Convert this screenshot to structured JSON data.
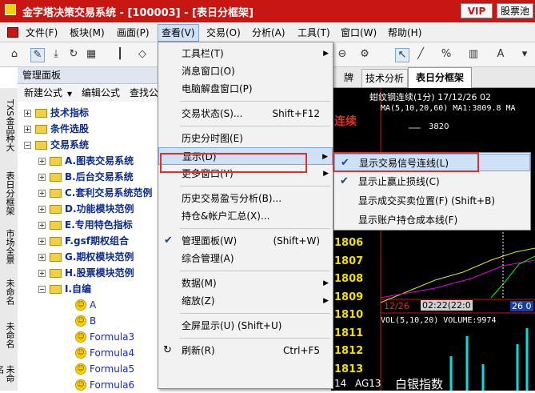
{
  "window": {
    "title": "金字塔决策交易系统 - [100003] - [表日分框架]",
    "vip": "VIP",
    "pool": "股票池"
  },
  "menubar": [
    "文件(F)",
    "板块(M)",
    "画面(P)",
    "查看(V)",
    "交易(O)",
    "分析(A)",
    "工具(T)",
    "窗口(W)",
    "帮助(H)"
  ],
  "left_tabs": [
    "TXS金品种大",
    "表日分框架",
    "市场全景",
    "未命名",
    "未命名",
    "未命名"
  ],
  "panel": {
    "title": "管理面板",
    "tools": [
      "新建公式",
      "编辑公式",
      "查找公"
    ]
  },
  "tree": [
    {
      "label": "技术指标",
      "level": 0,
      "open": false
    },
    {
      "label": "条件选股",
      "level": 0,
      "open": false
    },
    {
      "label": "交易系统",
      "level": 0,
      "open": true
    },
    {
      "label": "A.图表交易系统",
      "level": 1,
      "open": false
    },
    {
      "label": "B.后台交易系统",
      "level": 1,
      "open": false
    },
    {
      "label": "C.套利交易系统范例",
      "level": 1,
      "open": false
    },
    {
      "label": "D.功能模块范例",
      "level": 1,
      "open": false
    },
    {
      "label": "E.专用特色指标",
      "level": 1,
      "open": false
    },
    {
      "label": "F.gsf期权组合",
      "level": 1,
      "open": false
    },
    {
      "label": "G.期权模块范例",
      "level": 1,
      "open": false
    },
    {
      "label": "H.股票模块范例",
      "level": 1,
      "open": false
    },
    {
      "label": "I.自编",
      "level": 1,
      "open": true
    },
    {
      "label": "A",
      "level": 2,
      "leaf": true
    },
    {
      "label": "B",
      "level": 2,
      "leaf": true
    },
    {
      "label": "Formula3",
      "level": 2,
      "leaf": true
    },
    {
      "label": "Formula4",
      "level": 2,
      "leaf": true
    },
    {
      "label": "Formula5",
      "level": 2,
      "leaf": true
    },
    {
      "label": "Formula6",
      "level": 2,
      "leaf": true
    }
  ],
  "view_menu": [
    {
      "label": "工具栏(T)",
      "shortcut": "",
      "submenu": true
    },
    {
      "label": "消息窗口(O)",
      "shortcut": ""
    },
    {
      "label": "电脑解盘窗口(P)",
      "shortcut": ""
    },
    {
      "sep": true
    },
    {
      "label": "交易状态(S)...",
      "shortcut": "Shift+F12"
    },
    {
      "sep": true
    },
    {
      "label": "历史分时图(E)",
      "shortcut": ""
    },
    {
      "label": "显示(D)",
      "shortcut": "",
      "submenu": true,
      "highlight": true
    },
    {
      "label": "更多窗口(Y)",
      "shortcut": "",
      "submenu": true
    },
    {
      "sep": true
    },
    {
      "label": "历史交易盈亏分析(B)...",
      "shortcut": ""
    },
    {
      "label": "持仓&帐户汇总(X)...",
      "shortcut": ""
    },
    {
      "sep": true
    },
    {
      "label": "管理面板(W)",
      "shortcut": "(Shift+W)",
      "checked": true
    },
    {
      "label": "综合管理(A)",
      "shortcut": ""
    },
    {
      "sep": true
    },
    {
      "label": "数据(M)",
      "shortcut": "",
      "submenu": true
    },
    {
      "label": "缩放(Z)",
      "shortcut": "",
      "submenu": true
    },
    {
      "sep": true
    },
    {
      "label": "全屏显示(U) (Shift+U)",
      "shortcut": ""
    },
    {
      "sep": true
    },
    {
      "label": "刷新(R)",
      "shortcut": "Ctrl+F5"
    }
  ],
  "display_submenu": [
    {
      "label": "显示交易信号连线(L)",
      "checked": true,
      "highlight": true
    },
    {
      "label": "显示止赢止损线(C)",
      "checked": true
    },
    {
      "label": "显示成交买卖位置(F)   (Shift+B)",
      "checked": false
    },
    {
      "label": "显示账户持仓成本线(F)",
      "checked": false
    }
  ],
  "right_tabs": [
    "牌",
    "技术分析",
    "表日分框架"
  ],
  "chart": {
    "title": "蚶纹钢连续(1分)  17/12/26 02",
    "ma": "MA(5,10,20,60)  MA1:3809.8 MA",
    "lian": "连续",
    "level_3820": "3820",
    "prices": [
      "1806",
      "1807",
      "1808",
      "1809",
      "1810",
      "1811",
      "1812",
      "1813"
    ],
    "time_left": "12/26",
    "time_mid": "02:22(22:0",
    "time_right": "26  0",
    "vol": "VOL(5,10,20)  VOLUME:9974",
    "footer_num": "14",
    "footer_code": "AG13",
    "footer_name": "白银指数"
  }
}
